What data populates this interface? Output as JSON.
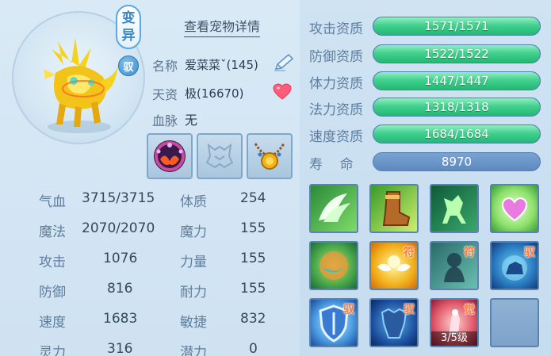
{
  "header": {
    "mutant_badge": [
      "变",
      "异"
    ],
    "bound_badge": "驭",
    "detail_link": "查看宠物详情"
  },
  "info": {
    "name_label": "名称",
    "name_value": "爱菜菜ˇ(145)",
    "talent_label": "天资",
    "talent_value": "极(16670)",
    "bloodline_label": "血脉",
    "bloodline_value": "无"
  },
  "icons": {
    "edit": "edit-pen-icon",
    "favorite": "heart-icon",
    "equipment": [
      "collar-equip-icon",
      "armor-slot-empty-icon",
      "necklace-equip-icon"
    ]
  },
  "stats": [
    {
      "label": "气血",
      "value": "3715/3715",
      "label2": "体质",
      "value2": "254"
    },
    {
      "label": "魔法",
      "value": "2070/2070",
      "label2": "魔力",
      "value2": "155"
    },
    {
      "label": "攻击",
      "value": "1076",
      "label2": "力量",
      "value2": "155"
    },
    {
      "label": "防御",
      "value": "816",
      "label2": "耐力",
      "value2": "155"
    },
    {
      "label": "速度",
      "value": "1683",
      "label2": "敏捷",
      "value2": "832"
    },
    {
      "label": "灵力",
      "value": "316",
      "label2": "潜力",
      "value2": "0"
    }
  ],
  "aptitudes": [
    {
      "label": "攻击资质",
      "value": "1571/1571",
      "fill": 1.0
    },
    {
      "label": "防御资质",
      "value": "1522/1522",
      "fill": 1.0
    },
    {
      "label": "体力资质",
      "value": "1447/1447",
      "fill": 1.0
    },
    {
      "label": "法力资质",
      "value": "1318/1318",
      "fill": 1.0
    },
    {
      "label": "速度资质",
      "value": "1684/1684",
      "fill": 1.0
    }
  ],
  "lifespan": {
    "label": "寿    命",
    "value": "8970"
  },
  "skills": [
    {
      "name": "wings-skill-icon",
      "tag": "",
      "level": ""
    },
    {
      "name": "boot-skill-icon",
      "tag": "",
      "level": ""
    },
    {
      "name": "horse-skill-icon",
      "tag": "",
      "level": ""
    },
    {
      "name": "heart-skill-icon",
      "tag": "",
      "level": ""
    },
    {
      "name": "orb-skill-icon",
      "tag": "",
      "level": ""
    },
    {
      "name": "sun-wings-skill-icon",
      "tag": "符",
      "level": ""
    },
    {
      "name": "ghost-skill-icon",
      "tag": "符",
      "level": ""
    },
    {
      "name": "beast-orb-skill-icon",
      "tag": "驭",
      "level": ""
    },
    {
      "name": "shield-skill-icon",
      "tag": "驭",
      "level": ""
    },
    {
      "name": "armor-skill-icon",
      "tag": "驭",
      "level": ""
    },
    {
      "name": "awaken-skill-icon",
      "tag": "觉",
      "level": "3/5级"
    },
    {
      "name": "empty-skill-slot",
      "tag": "",
      "level": ""
    }
  ],
  "colors": {
    "bar_fill": "#3fcf8c",
    "bar_track": "#5e8fc4",
    "label": "#5f7d9d",
    "value": "#34495e",
    "tag": "#ff7a36"
  }
}
